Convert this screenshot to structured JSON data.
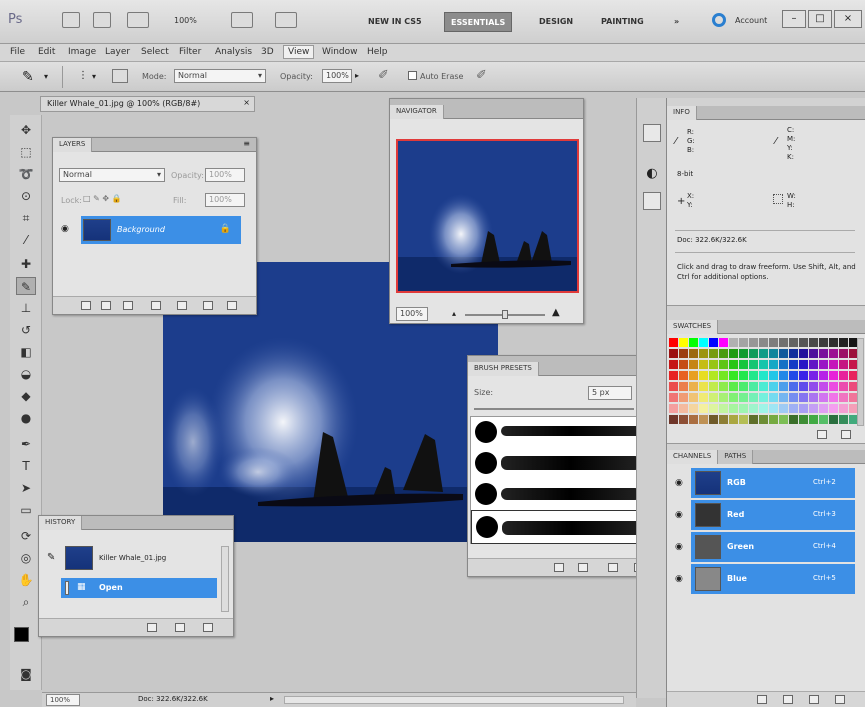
{
  "appbar": {
    "logo": "Ps",
    "zoom": "100%",
    "workspaces": [
      "NEW IN CS5",
      "ESSENTIALS",
      "DESIGN",
      "PAINTING"
    ],
    "active_workspace": "ESSENTIALS",
    "more": "»",
    "account": "Account"
  },
  "menu": [
    "File",
    "Edit",
    "Image",
    "Layer",
    "Select",
    "Filter",
    "Analysis",
    "3D",
    "View",
    "Window",
    "Help"
  ],
  "options": {
    "mode_label": "Mode:",
    "mode_value": "Normal",
    "opacity_label": "Opacity:",
    "opacity_value": "100%",
    "auto_erase": "Auto Erase"
  },
  "document": {
    "tab_title": "Killer Whale_01.jpg @ 100% (RGB/8#)"
  },
  "layers": {
    "tab": "LAYERS",
    "blend": "Normal",
    "opacity_label": "Opacity:",
    "opacity_value": "100%",
    "lock_label": "Lock:",
    "fill_label": "Fill:",
    "fill_value": "100%",
    "layer_name": "Background"
  },
  "navigator": {
    "tab": "NAVIGATOR",
    "zoom": "100%"
  },
  "brush_presets": {
    "tab": "BRUSH PRESETS",
    "size_label": "Size:",
    "size_value": "5 px"
  },
  "history": {
    "tab": "HISTORY",
    "snapshot": "Killer Whale_01.jpg",
    "state": "Open"
  },
  "info": {
    "tab": "INFO",
    "rgb_labels": [
      "R:",
      "G:",
      "B:"
    ],
    "cmyk_labels": [
      "C:",
      "M:",
      "Y:",
      "K:"
    ],
    "bit_depth": "8-bit",
    "xy_labels": [
      "X:",
      "Y:"
    ],
    "wh_labels": [
      "W:",
      "H:"
    ],
    "doc_size": "Doc: 322.6K/322.6K",
    "hint": "Click and drag to draw freeform. Use Shift, Alt, and Ctrl for additional options."
  },
  "swatches": {
    "tab": "SWATCHES"
  },
  "channels": {
    "tabs": [
      "CHANNELS",
      "PATHS"
    ],
    "rows": [
      {
        "name": "RGB",
        "shortcut": "Ctrl+2"
      },
      {
        "name": "Red",
        "shortcut": "Ctrl+3"
      },
      {
        "name": "Green",
        "shortcut": "Ctrl+4"
      },
      {
        "name": "Blue",
        "shortcut": "Ctrl+5"
      }
    ]
  },
  "status": {
    "zoom": "100%",
    "doc": "Doc: 322.6K/322.6K"
  }
}
